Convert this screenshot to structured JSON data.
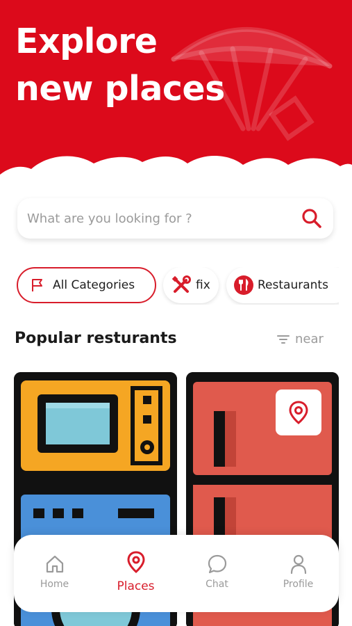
{
  "colors": {
    "accent": "#dc0a1b",
    "text": "#1e1e1e",
    "muted": "#9a9a9a"
  },
  "hero": {
    "title_line1": "Explore",
    "title_line2": "new places"
  },
  "search": {
    "placeholder": "What are you looking for ?",
    "icon": "search-icon"
  },
  "categories": [
    {
      "label": "All Categories",
      "icon": "flag-icon",
      "selected": true
    },
    {
      "label": "fix",
      "icon": "tools-icon",
      "selected": false
    },
    {
      "label": "Restaurants",
      "icon": "cutlery-icon",
      "selected": false
    }
  ],
  "section": {
    "title": "Popular resturants",
    "sort_label": "near"
  },
  "nav": [
    {
      "label": "Home",
      "icon": "home-icon",
      "active": false
    },
    {
      "label": "Places",
      "icon": "location-pin-icon",
      "active": true
    },
    {
      "label": "Chat",
      "icon": "chat-bubble-icon",
      "active": false
    },
    {
      "label": "Profile",
      "icon": "person-icon",
      "active": false
    }
  ]
}
